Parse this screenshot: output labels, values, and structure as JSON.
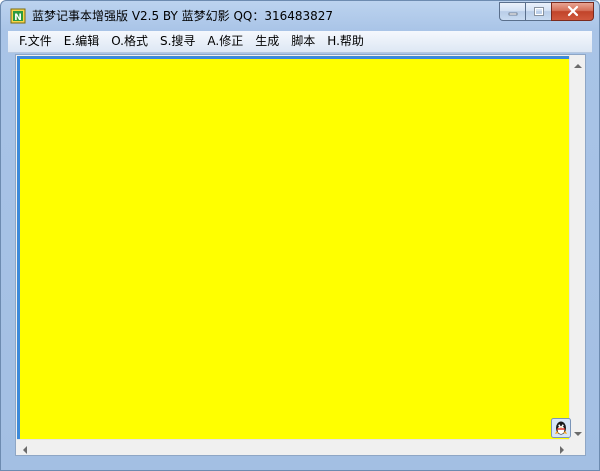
{
  "window": {
    "title": "蓝梦记事本增强版 V2.5 BY 蓝梦幻影 QQ：316483827"
  },
  "menu": {
    "items": [
      {
        "label": "F.文件"
      },
      {
        "label": "E.编辑"
      },
      {
        "label": "O.格式"
      },
      {
        "label": "S.搜寻"
      },
      {
        "label": "A.修正"
      },
      {
        "label": "生成"
      },
      {
        "label": "脚本"
      },
      {
        "label": "H.帮助"
      }
    ]
  },
  "editor": {
    "content": "",
    "background_color": "#ffff00"
  },
  "icons": {
    "app": "notepad-app-icon",
    "qq": "qq-penguin-icon",
    "minimize": "minimize-icon",
    "maximize": "maximize-icon",
    "close": "close-icon"
  }
}
